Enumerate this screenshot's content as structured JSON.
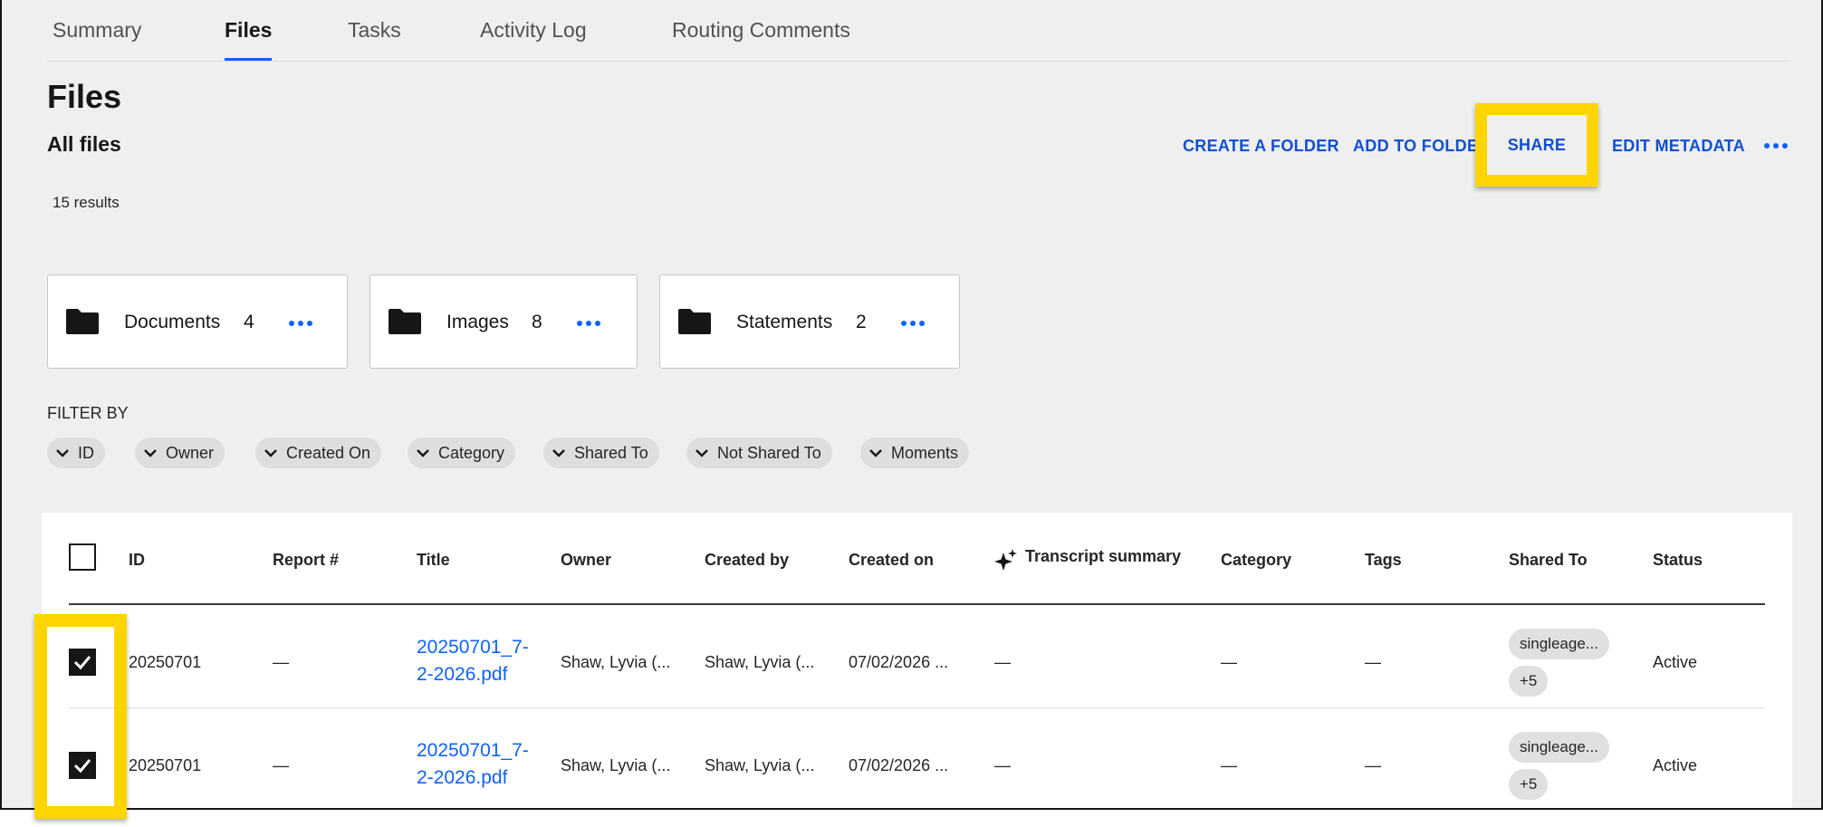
{
  "tabs": [
    {
      "label": "Summary"
    },
    {
      "label": "Files",
      "active": true
    },
    {
      "label": "Tasks"
    },
    {
      "label": "Activity Log"
    },
    {
      "label": "Routing Comments"
    }
  ],
  "page": {
    "title": "Files",
    "subtitle": "All files",
    "results": "15 results"
  },
  "toolbar": {
    "create_folder": "CREATE A FOLDER",
    "add_to_folder": "ADD TO FOLDE",
    "share": "SHARE",
    "edit_metadata": "EDIT METADATA",
    "more_icon": "overflow-menu-icon"
  },
  "folders": [
    {
      "name": "Documents",
      "count": "4"
    },
    {
      "name": "Images",
      "count": "8"
    },
    {
      "name": "Statements",
      "count": "2"
    }
  ],
  "filter": {
    "label": "FILTER BY",
    "chips": [
      "ID",
      "Owner",
      "Created On",
      "Category",
      "Shared To",
      "Not Shared To",
      "Moments"
    ]
  },
  "table": {
    "headers": {
      "id": "ID",
      "report": "Report #",
      "title": "Title",
      "owner": "Owner",
      "created_by": "Created by",
      "created_on": "Created on",
      "transcript": "Transcript summary",
      "category": "Category",
      "tags": "Tags",
      "shared_to": "Shared To",
      "status": "Status"
    },
    "rows": [
      {
        "checked": true,
        "id": "20250701",
        "report": "—",
        "title": "20250701_7-2-2026.pdf",
        "owner": "Shaw, Lyvia (...",
        "created_by": "Shaw, Lyvia (...",
        "created_on": "07/02/2026 ...",
        "transcript": "—",
        "category": "—",
        "tags": "—",
        "shared_tag": "singleage...",
        "shared_more": "+5",
        "status": "Active"
      },
      {
        "checked": true,
        "id": "20250701",
        "report": "—",
        "title": "20250701_7-2-2026.pdf",
        "owner": "Shaw, Lyvia (...",
        "created_by": "Shaw, Lyvia (...",
        "created_on": "07/02/2026 ...",
        "transcript": "—",
        "category": "—",
        "tags": "—",
        "shared_tag": "singleage...",
        "shared_more": "+5",
        "status": "Active"
      }
    ]
  },
  "colors": {
    "accent": "#0f62fe",
    "highlight": "#ffd500",
    "background": "#efefef"
  }
}
